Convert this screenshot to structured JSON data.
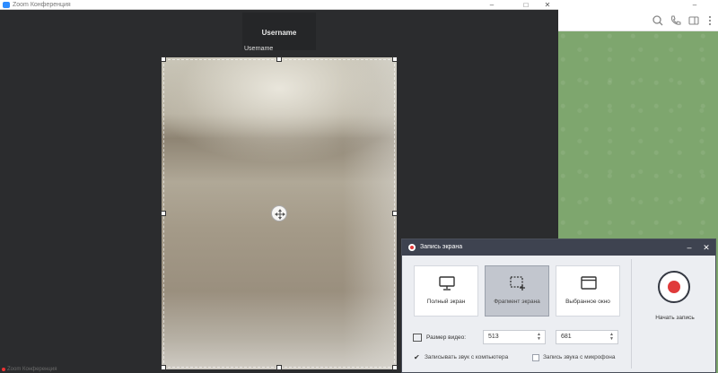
{
  "zoom": {
    "window_title": "Zoom Конференция",
    "participant_name_card": "Username",
    "participant_label": "Username",
    "bottom_text": "Zoom Конференция",
    "window_buttons": [
      "–",
      "□",
      "✕"
    ]
  },
  "recorder": {
    "title": "Запись экрана",
    "modes": [
      {
        "label": "Полный экран",
        "icon": "monitor-icon",
        "active": false
      },
      {
        "label": "Фрагмент экрана",
        "icon": "fragment-select-icon",
        "active": true
      },
      {
        "label": "Выбранное окно",
        "icon": "window-icon",
        "active": false
      }
    ],
    "record_button_label": "Начать запись",
    "video_size_label": "Размер видео:",
    "width_value": "513",
    "height_value": "681",
    "record_system_audio_label": "Записывать звук с компьютера",
    "record_system_audio_checked": true,
    "record_mic_label": "Запись звука с микрофона",
    "record_mic_checked": false
  },
  "colors": {
    "record_red": "#e03b3b",
    "dialog_titlebar": "#3e4350",
    "telegram_bg": "#7ea66e"
  }
}
